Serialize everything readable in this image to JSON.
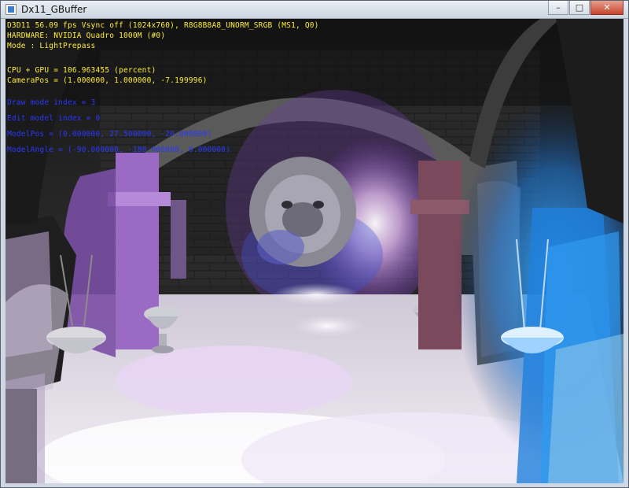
{
  "window": {
    "title": "Dx11_GBuffer",
    "controls": {
      "minimize": "–",
      "maximize": "□",
      "close": "✕"
    }
  },
  "hud": {
    "info_lines": [
      "D3D11 56.09 fps Vsync off (1024x760), R8G8B8A8_UNORM_SRGB (MS1, Q0)",
      "HARDWARE: NVIDIA Quadro 1000M  (#0)",
      "Mode : LightPrepass"
    ],
    "stat_lines": [
      "CPU + GPU = 106.963455 (percent)",
      "CameraPos = (1.000000, 1.000000, -7.199996)"
    ],
    "debug_lines": [
      "Draw mode index = 3",
      "Edit model index = 0",
      "ModelPos = (0.000000, 27.500000, -20.000000)",
      "ModelAngle = (-90.000000, -180.000000, 0.000000)"
    ]
  },
  "colors": {
    "hud_yellow": "#ffee33",
    "hud_blue": "#2a38ff",
    "light_magenta": "#c38ae6",
    "light_blue": "#1d8fe8"
  },
  "icons": [
    "app-icon",
    "minimize-icon",
    "maximize-icon",
    "close-icon"
  ]
}
